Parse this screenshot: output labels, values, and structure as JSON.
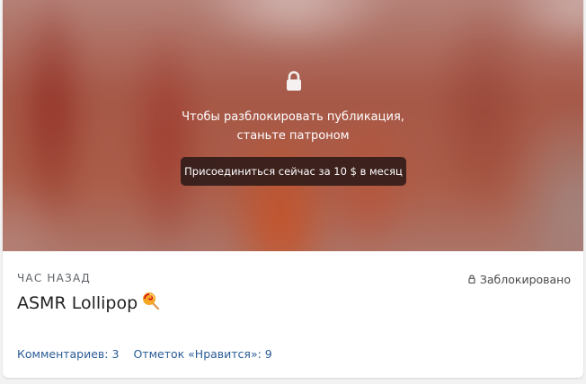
{
  "post": {
    "media": {
      "lock_icon": "lock-icon",
      "unlock_line1": "Чтобы разблокировать публикация,",
      "unlock_line2": "станьте патроном",
      "join_label": "Присоединиться сейчас за 10 $ в месяц"
    },
    "time_label": "ЧАС НАЗАД",
    "lock_status": "Заблокировано",
    "title": "ASMR Lollipop",
    "title_emoji": "lollipop-icon",
    "comments_label": "Комментариев: 3",
    "likes_label": "Отметок «Нравится»: 9"
  },
  "colors": {
    "link": "#2a5c96",
    "title": "#222222",
    "button_bg": "#2a1816"
  }
}
